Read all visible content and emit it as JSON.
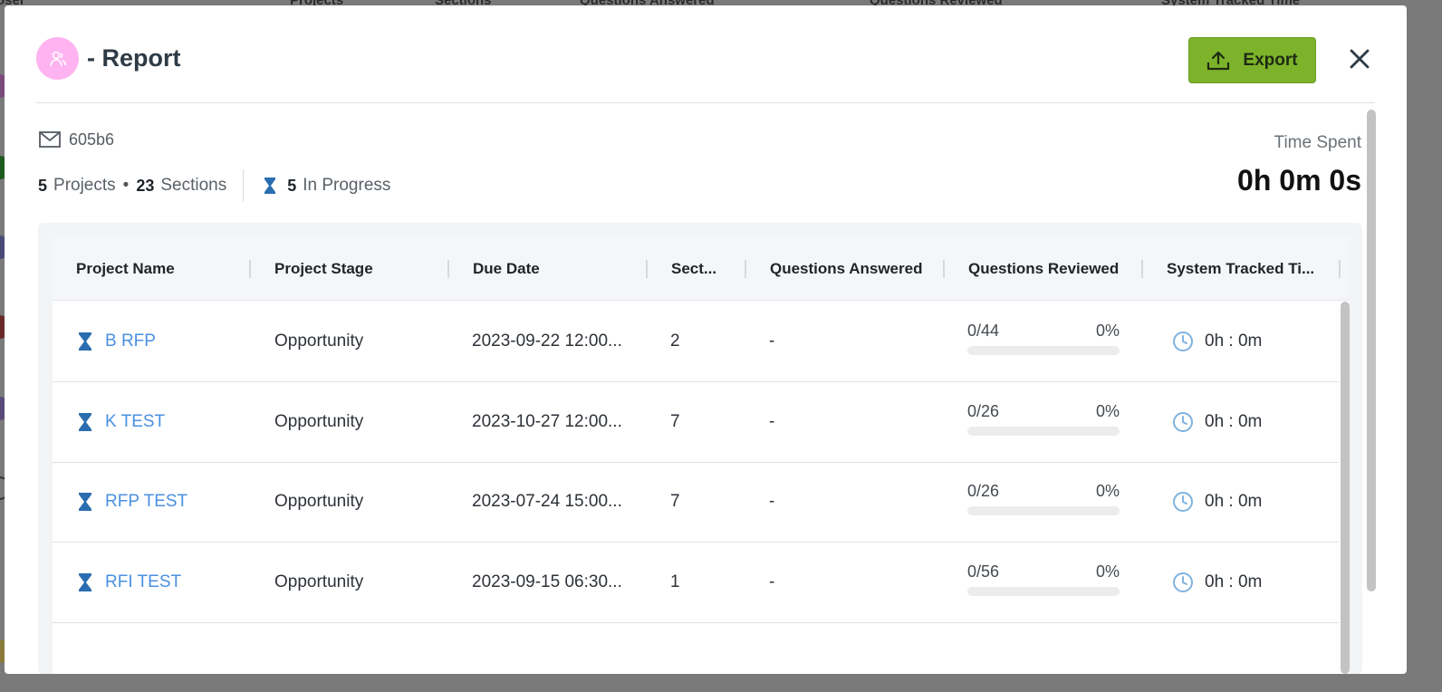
{
  "background": {
    "columns": [
      "Projects",
      "Sections",
      "Questions Answered",
      "Questions Reviewed",
      "System Tracked Time"
    ]
  },
  "modal": {
    "title": "- Report",
    "export_label": "Export",
    "email": "605b6",
    "stats": {
      "projects_count": "5",
      "projects_label": "Projects",
      "sections_count": "23",
      "sections_label": "Sections",
      "in_progress_count": "5",
      "in_progress_label": "In Progress"
    },
    "time_spent_label": "Time Spent",
    "time_spent_value": "0h 0m 0s"
  },
  "table": {
    "headers": [
      "Project Name",
      "Project Stage",
      "Due Date",
      "Sect...",
      "Questions Answered",
      "Questions Reviewed",
      "System Tracked Ti..."
    ],
    "rows": [
      {
        "name": "B RFP",
        "stage": "Opportunity",
        "due": "2023-09-22 12:00...",
        "sections": "2",
        "answered": "-",
        "reviewed": "0/44",
        "pct": "0%",
        "time": "0h : 0m"
      },
      {
        "name": "K TEST",
        "stage": "Opportunity",
        "due": "2023-10-27 12:00...",
        "sections": "7",
        "answered": "-",
        "reviewed": "0/26",
        "pct": "0%",
        "time": "0h : 0m"
      },
      {
        "name": "RFP TEST",
        "stage": "Opportunity",
        "due": "2023-07-24 15:00...",
        "sections": "7",
        "answered": "-",
        "reviewed": "0/26",
        "pct": "0%",
        "time": "0h : 0m"
      },
      {
        "name": "RFI TEST",
        "stage": "Opportunity",
        "due": "2023-09-15 06:30...",
        "sections": "1",
        "answered": "-",
        "reviewed": "0/56",
        "pct": "0%",
        "time": "0h : 0m"
      }
    ]
  },
  "colors": {
    "export": "#7cb32b",
    "link": "#4a90e2",
    "hourglass": "#2a6db0",
    "avatar": "#ffb3f0"
  }
}
